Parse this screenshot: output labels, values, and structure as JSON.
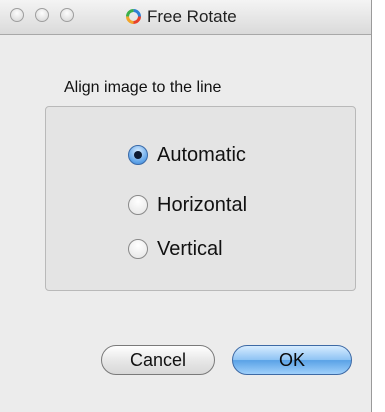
{
  "window": {
    "title": "Free Rotate"
  },
  "group": {
    "label": "Align image to the line"
  },
  "options": [
    {
      "label": "Automatic",
      "selected": true
    },
    {
      "label": "Horizontal",
      "selected": false
    },
    {
      "label": "Vertical",
      "selected": false
    }
  ],
  "buttons": {
    "cancel_label": "Cancel",
    "ok_label": "OK"
  }
}
